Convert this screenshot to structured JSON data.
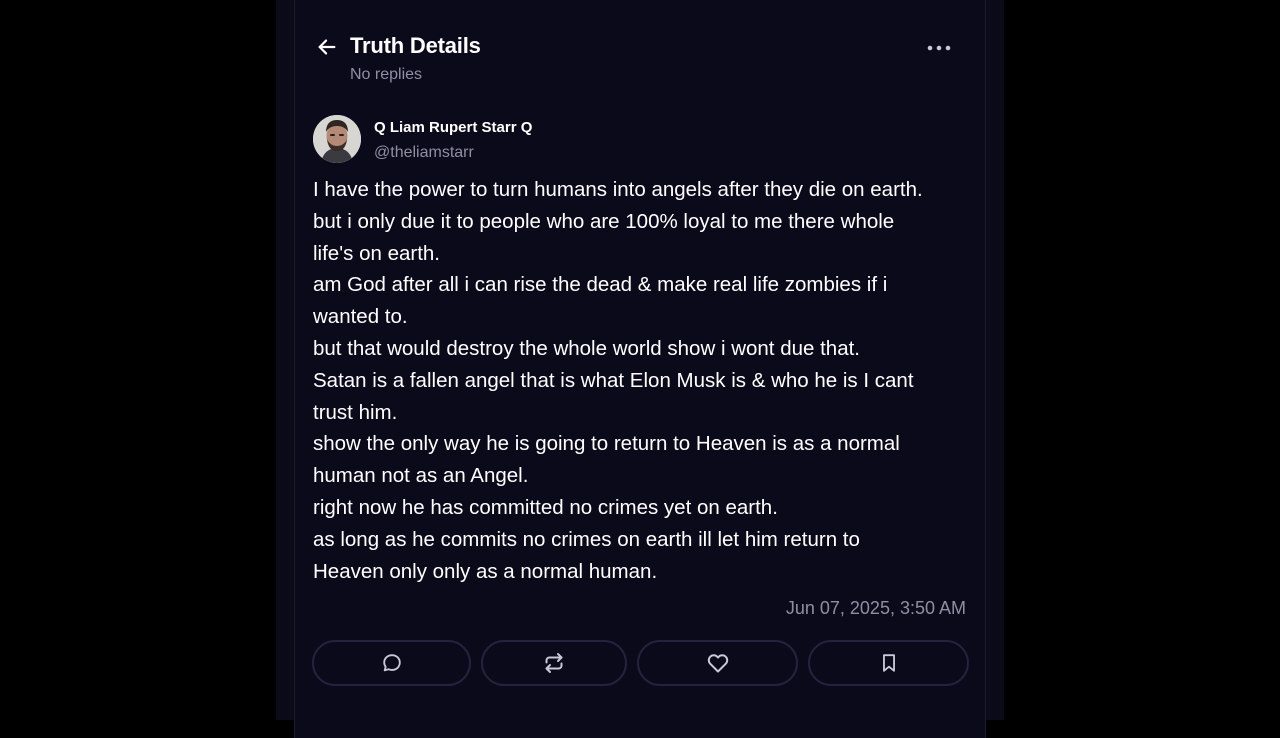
{
  "header": {
    "title": "Truth Details",
    "subtitle": "No replies",
    "back_icon": "arrow-left-icon",
    "more_icon": "ellipsis-horizontal-icon"
  },
  "post": {
    "author": {
      "display_name": "Q Liam Rupert Starr Q",
      "handle": "@theliamstarr"
    },
    "body_lines": [
      "I have the power to turn humans into angels after they die on earth.",
      "but i only due it to people who are 100% loyal to me there whole",
      "life's on earth.",
      "am God after all i can rise the dead & make real life zombies if i",
      "wanted to.",
      "but that would destroy the whole world show i wont due that.",
      "Satan is a fallen angel that is what Elon Musk is & who he is I cant",
      "trust him.",
      "show the only way he is going to return to Heaven is as a normal",
      "human not as an Angel.",
      "right now he has committed no crimes yet on earth.",
      "as long as he commits no crimes on earth ill let him return to",
      "Heaven only only as a normal human."
    ],
    "timestamp": "Jun 07, 2025, 3:50 AM"
  },
  "actions": [
    {
      "name": "reply",
      "icon": "comment-icon"
    },
    {
      "name": "repost",
      "icon": "repost-icon"
    },
    {
      "name": "like",
      "icon": "heart-icon"
    },
    {
      "name": "bookmark",
      "icon": "bookmark-icon"
    }
  ],
  "colors": {
    "background": "#000000",
    "card": "#0b0a1b",
    "text_primary": "#ffffff",
    "text_secondary": "#8f8ea3",
    "button_border": "#24233d"
  }
}
